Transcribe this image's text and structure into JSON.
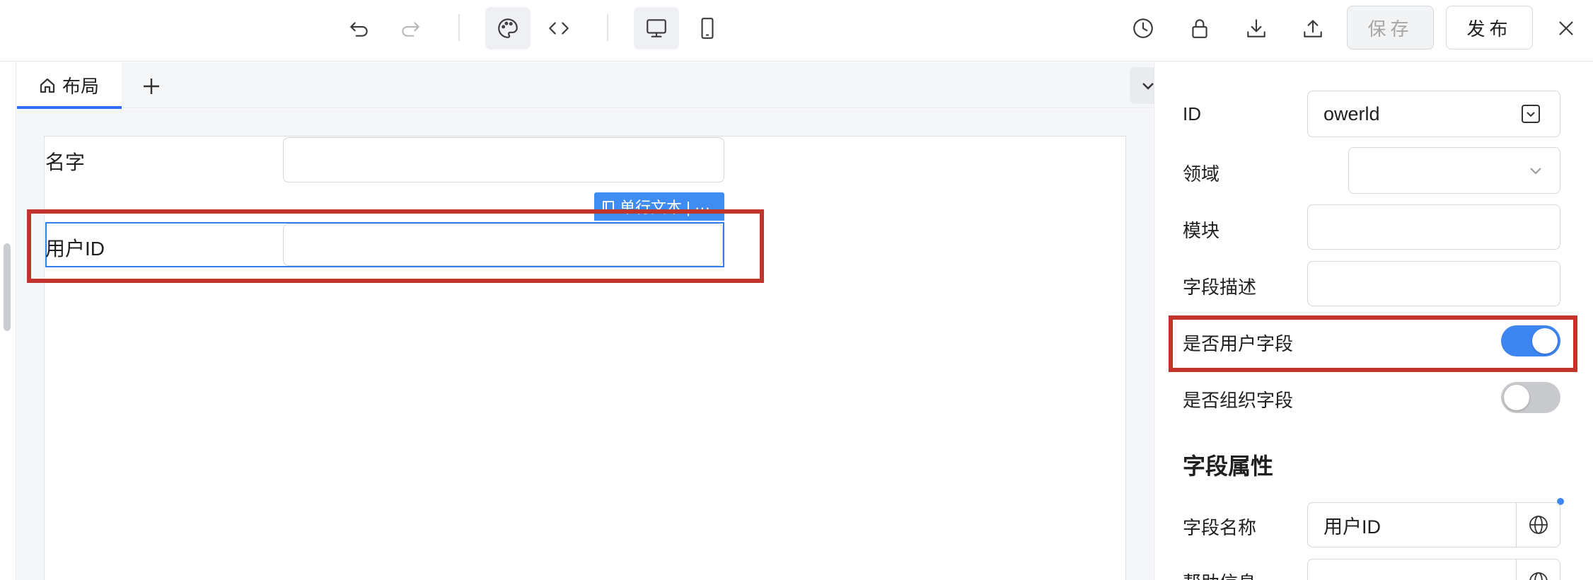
{
  "toolbar": {
    "icons": [
      "undo-icon",
      "redo-icon",
      "palette-icon",
      "code-icon",
      "desktop-icon",
      "mobile-icon",
      "history-icon",
      "lock-icon",
      "download-icon",
      "upload-icon",
      "close-icon"
    ],
    "save_label": "保存",
    "publish_label": "发布"
  },
  "tabs": [
    {
      "label": "布局",
      "icon": "home-icon",
      "active": true
    }
  ],
  "canvas": {
    "fields": [
      {
        "label": "名字",
        "value": ""
      },
      {
        "label": "用户ID",
        "value": "",
        "selected": true
      }
    ],
    "selected_component_tag": "单行文本 | ···"
  },
  "properties": {
    "id_label": "ID",
    "id_value": "owerld",
    "domain_label": "领域",
    "domain_value": "",
    "module_label": "模块",
    "module_value": "",
    "field_desc_label": "字段描述",
    "field_desc_value": "",
    "is_user_field_label": "是否用户字段",
    "is_user_field": true,
    "is_org_field_label": "是否组织字段",
    "is_org_field": false,
    "section_title": "字段属性",
    "field_name_label": "字段名称",
    "field_name_value": "用户ID",
    "help_info_label": "帮助信息"
  },
  "colors": {
    "accent": "#2f6ef5",
    "toggle_on": "#3d86f2",
    "highlight_red": "#c0342b"
  }
}
